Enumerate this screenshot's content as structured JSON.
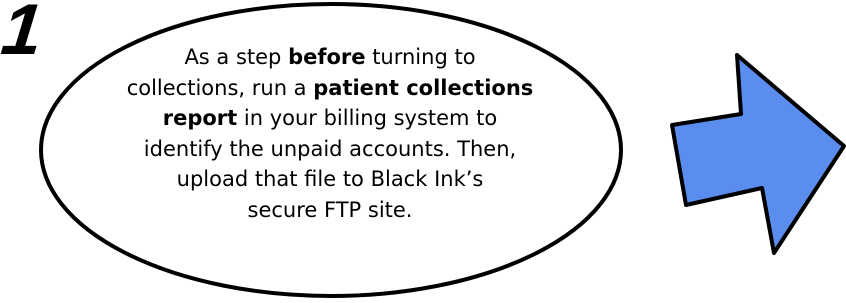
{
  "step": {
    "number": "1"
  },
  "callout": {
    "line1_pre": "As a step ",
    "line1_bold": "before",
    "line1_post": " turning to",
    "line2_pre": "collections, run a ",
    "line2_bold": "patient collections",
    "line3_bold": "report",
    "line3_post": " in your billing system to",
    "line4": "identify the unpaid accounts. Then,",
    "line5": "upload that file to Black Ink’s",
    "line6": "secure FTP site."
  },
  "arrow": {
    "icon": "right-arrow-icon",
    "fill_color": "#5b8def",
    "stroke_color": "#000000"
  }
}
